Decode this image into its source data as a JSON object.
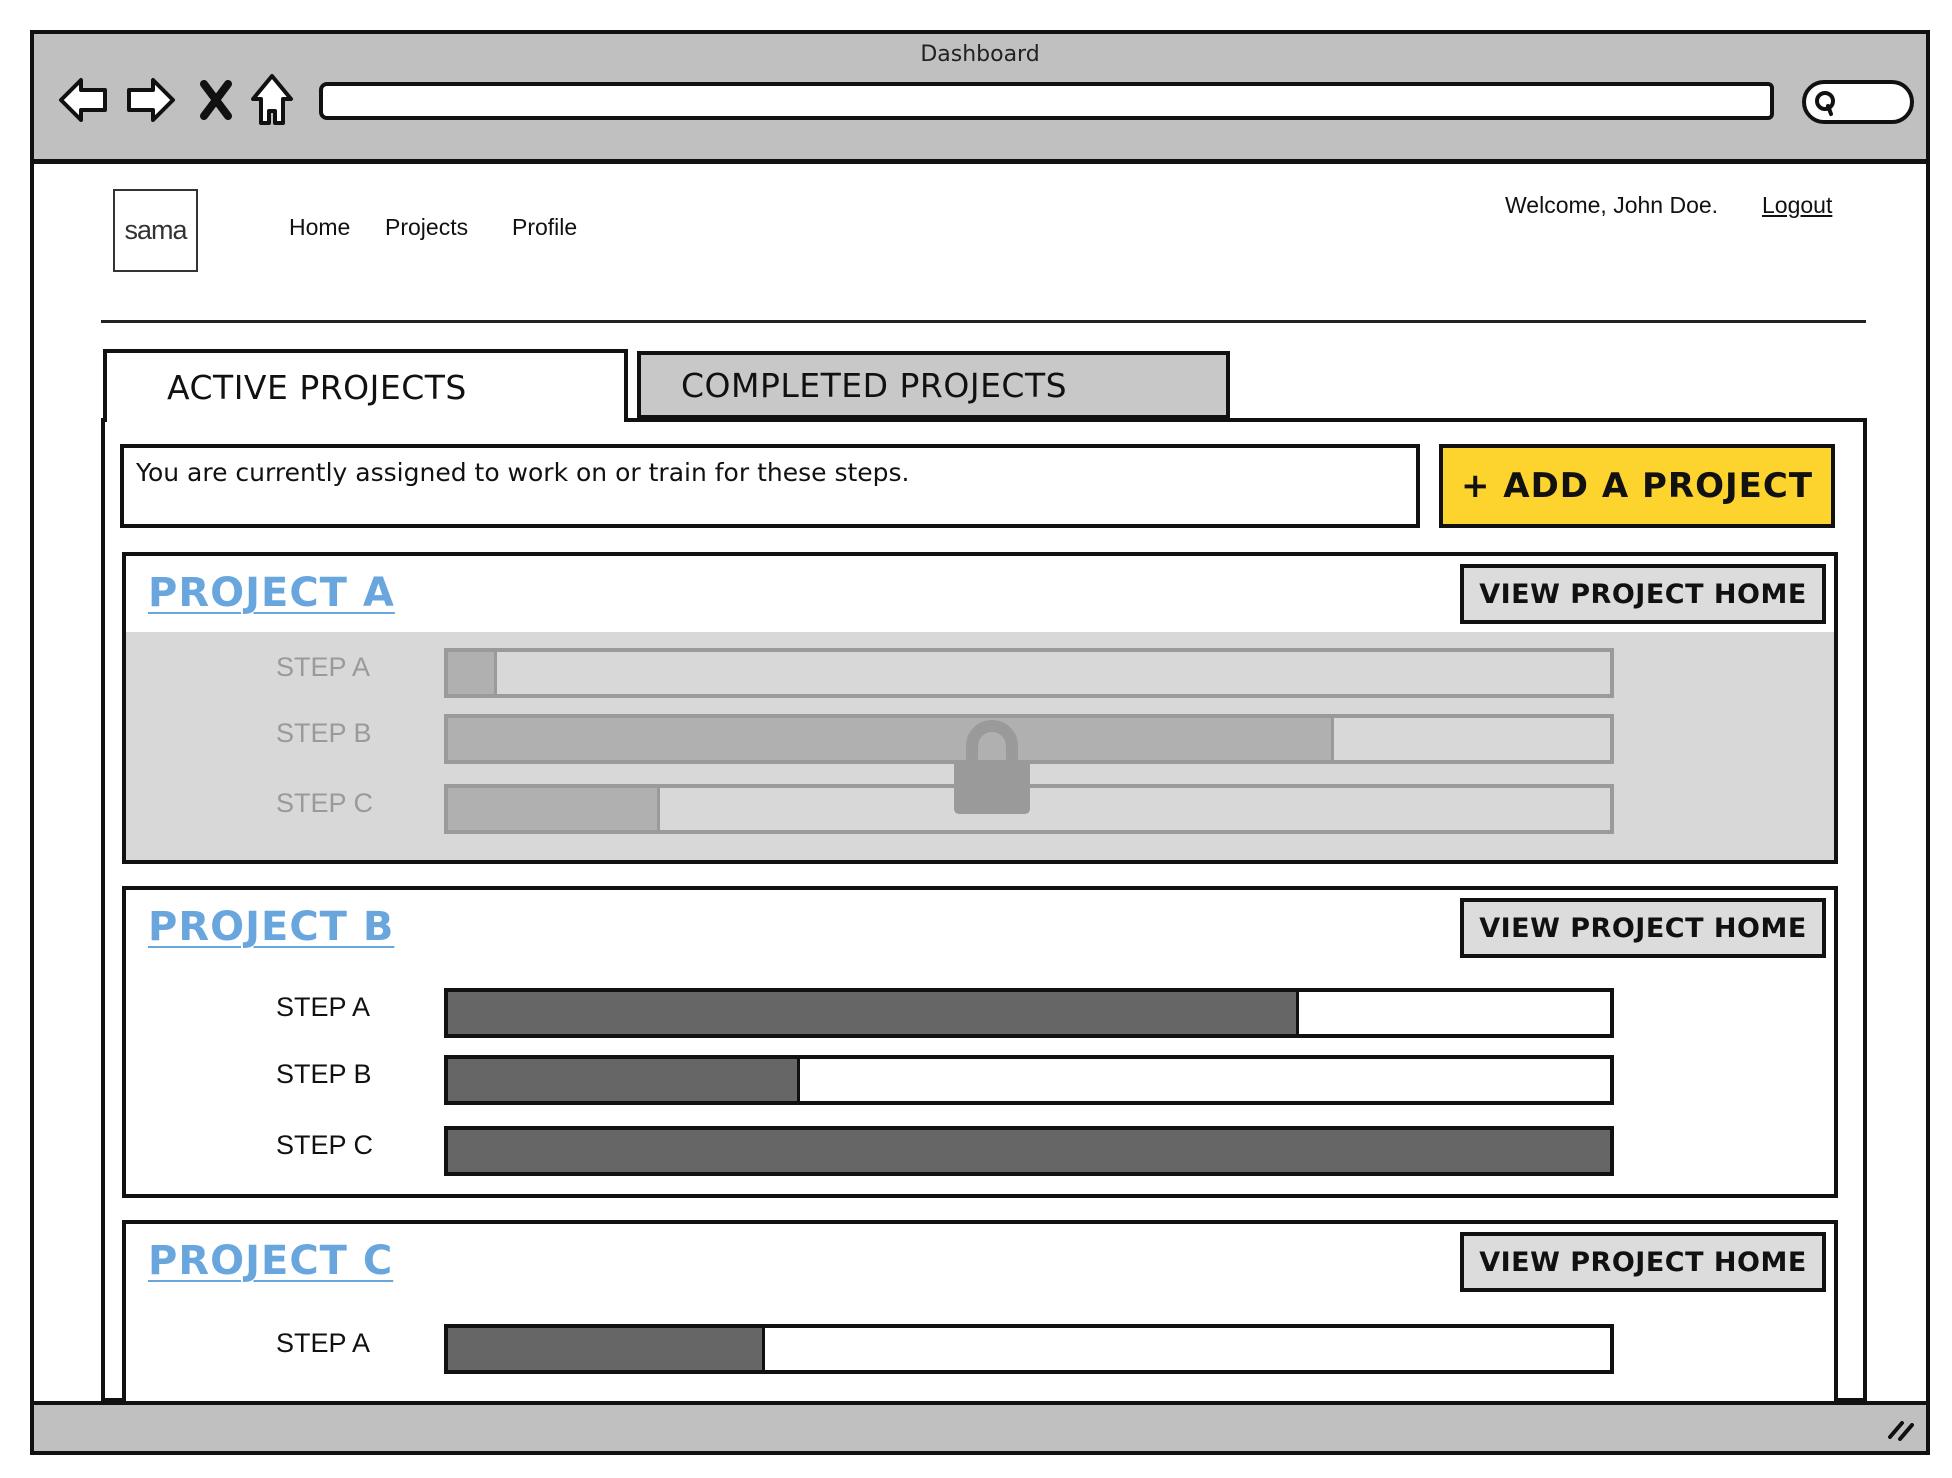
{
  "window": {
    "title": "Dashboard",
    "nav_icons": [
      "back-arrow-icon",
      "forward-arrow-icon",
      "stop-x-icon",
      "home-icon"
    ],
    "url_value": "",
    "search_icon": "search-icon",
    "resize_icon": "resize-grip-icon"
  },
  "header": {
    "logo_text": "sama",
    "nav": [
      {
        "label": "Home"
      },
      {
        "label": "Projects"
      },
      {
        "label": "Profile"
      }
    ],
    "welcome_text": "Welcome, John Doe.",
    "logout_label": "Logout"
  },
  "tabs": [
    {
      "label": "ACTIVE PROJECTS",
      "active": true
    },
    {
      "label": "COMPLETED PROJECTS",
      "active": false
    }
  ],
  "info_text": "You are currently assigned to work on or train for these steps.",
  "add_button_label": "+ ADD A PROJECT",
  "colors": {
    "accent_yellow": "#fdd42e",
    "project_link_blue": "#6aa6de",
    "progress_fill": "#666666",
    "locked_background": "#d8d8d8",
    "chrome_gray": "#c0c0c0"
  },
  "projects": [
    {
      "name": "PROJECT A",
      "view_button_label": "VIEW PROJECT HOME",
      "locked": true,
      "lock_icon": "lock-icon",
      "steps": [
        {
          "label": "STEP A",
          "progress": 0.04
        },
        {
          "label": "STEP B",
          "progress": 0.76
        },
        {
          "label": "STEP C",
          "progress": 0.18
        }
      ]
    },
    {
      "name": "PROJECT B",
      "view_button_label": "VIEW PROJECT HOME",
      "locked": false,
      "steps": [
        {
          "label": "STEP A",
          "progress": 0.73
        },
        {
          "label": "STEP B",
          "progress": 0.3
        },
        {
          "label": "STEP C",
          "progress": 1.0
        }
      ]
    },
    {
      "name": "PROJECT C",
      "view_button_label": "VIEW PROJECT HOME",
      "locked": false,
      "steps": [
        {
          "label": "STEP A",
          "progress": 0.27
        }
      ]
    }
  ]
}
